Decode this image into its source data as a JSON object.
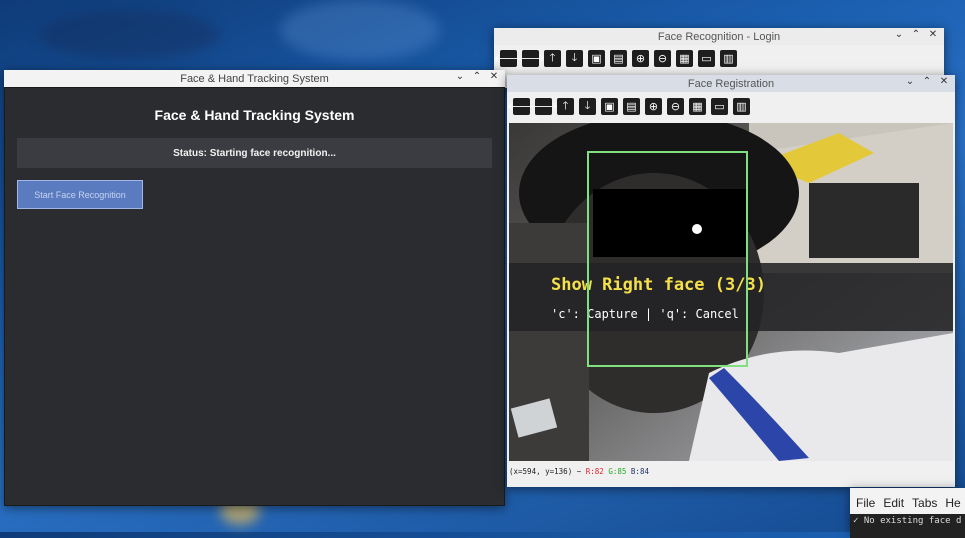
{
  "app": {
    "window_title": "Face & Hand Tracking System",
    "heading": "Face & Hand Tracking System",
    "status": "Status: Starting face recognition...",
    "start_button": "Start Face Recognition"
  },
  "login": {
    "window_title": "Face Recognition - Login"
  },
  "registration": {
    "window_title": "Face Registration",
    "toolbar_icons": [
      "arrow-left-icon",
      "arrow-right-icon",
      "arrow-up-icon",
      "arrow-down-icon",
      "pan-icon",
      "zoom-region-icon",
      "zoom-in-icon",
      "zoom-out-icon",
      "save-icon",
      "copy-icon",
      "properties-icon"
    ],
    "instruction": "Show Right face (3/3)",
    "keys_hint": "'c': Capture | 'q': Cancel",
    "pixel_info": "(x=594, y=136) ~",
    "pixel_r": "R:82",
    "pixel_g": "G:85",
    "pixel_b": "B:84",
    "colors": {
      "face_box": "#7ee07e",
      "instruction_text": "#f5e04a"
    }
  },
  "terminal": {
    "menu": [
      "File",
      "Edit",
      "Tabs",
      "He"
    ],
    "line": "✓ No existing face d"
  },
  "window_controls": [
    "chevron-down-icon",
    "chevron-up-icon",
    "close-icon"
  ]
}
